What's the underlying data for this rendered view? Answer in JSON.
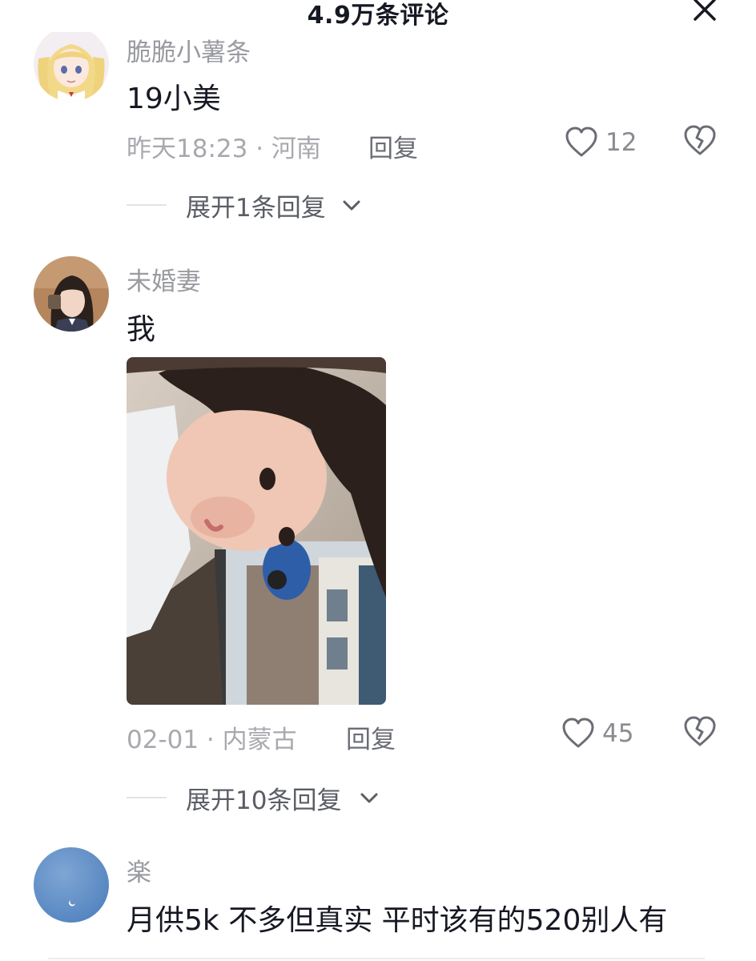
{
  "header": {
    "title": "4.9万条评论",
    "close_icon": "close-icon"
  },
  "comments": [
    {
      "username": "脆脆小薯条",
      "avatar_icon": "anime-girl-avatar",
      "text": "19小美",
      "time_location": "昨天18:23 · 河南",
      "reply_label": "回复",
      "likes": "12",
      "expand_label": "展开1条回复"
    },
    {
      "username": "未婚妻",
      "avatar_icon": "girl-photo-avatar",
      "text": "我",
      "image": "selfie-photo",
      "time_location": "02-01 · 内蒙古",
      "reply_label": "回复",
      "likes": "45",
      "expand_label": "展开10条回复"
    },
    {
      "username": "楽",
      "avatar_icon": "blue-sky-moon-avatar",
      "text": "月供5k  不多但真实  平时该有的520别人有"
    }
  ],
  "colors": {
    "text_primary": "#161823",
    "text_secondary": "#9a9ba1",
    "icon_gray": "#6b6d75"
  }
}
